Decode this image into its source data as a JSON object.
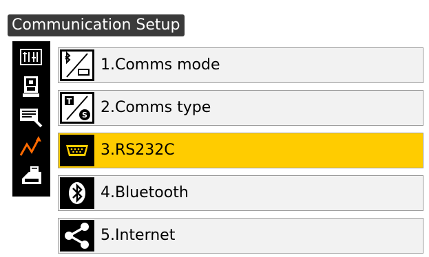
{
  "header": {
    "title": "Communication Setup"
  },
  "sidebar": {
    "icons": [
      "config-tabs-icon",
      "instrument-icon",
      "keyboard-pen-icon",
      "signal-graph-icon",
      "printer-icon"
    ]
  },
  "menu": {
    "items": [
      {
        "label": "1.Comms mode",
        "icon": "bluetooth-serial-toggle-icon",
        "selected": false
      },
      {
        "label": "2.Comms type",
        "icon": "comms-type-ts-icon",
        "selected": false
      },
      {
        "label": "3.RS232C",
        "icon": "serial-port-icon",
        "selected": true
      },
      {
        "label": "4.Bluetooth",
        "icon": "bluetooth-icon",
        "selected": false
      },
      {
        "label": "5.Internet",
        "icon": "share-icon",
        "selected": false
      }
    ]
  },
  "colors": {
    "selected_background": "#ffcc00",
    "item_background": "#f2f2f2",
    "title_background": "#3a3a3a",
    "signal_accent": "#ff6a00"
  }
}
